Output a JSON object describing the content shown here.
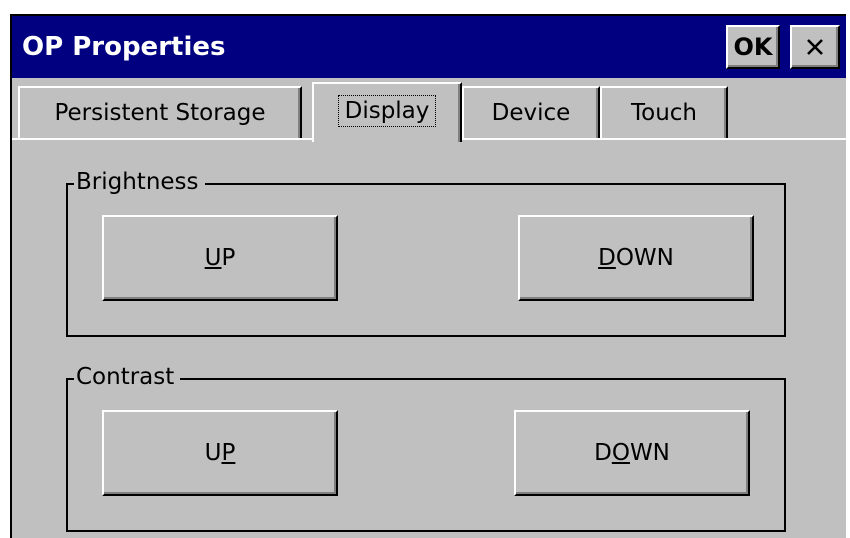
{
  "window": {
    "title": "OP Properties",
    "ok_label": "OK",
    "close_icon": "close-icon"
  },
  "tabs": [
    {
      "label": "Persistent Storage",
      "selected": false
    },
    {
      "label": "Display",
      "selected": true
    },
    {
      "label": "Device",
      "selected": false
    },
    {
      "label": "Touch",
      "selected": false
    }
  ],
  "brightness": {
    "label": "Brightness",
    "up": {
      "before": "",
      "mnemonic": "U",
      "after": "P"
    },
    "down": {
      "before": "",
      "mnemonic": "D",
      "after": "OWN"
    }
  },
  "contrast": {
    "label": "Contrast",
    "up": {
      "before": "U",
      "mnemonic": "P",
      "after": ""
    },
    "down": {
      "before": "D",
      "mnemonic": "O",
      "after": "WN"
    }
  },
  "colors": {
    "titlebar": "#000080",
    "face": "#c0c0c0",
    "title_text": "#ffffff"
  }
}
